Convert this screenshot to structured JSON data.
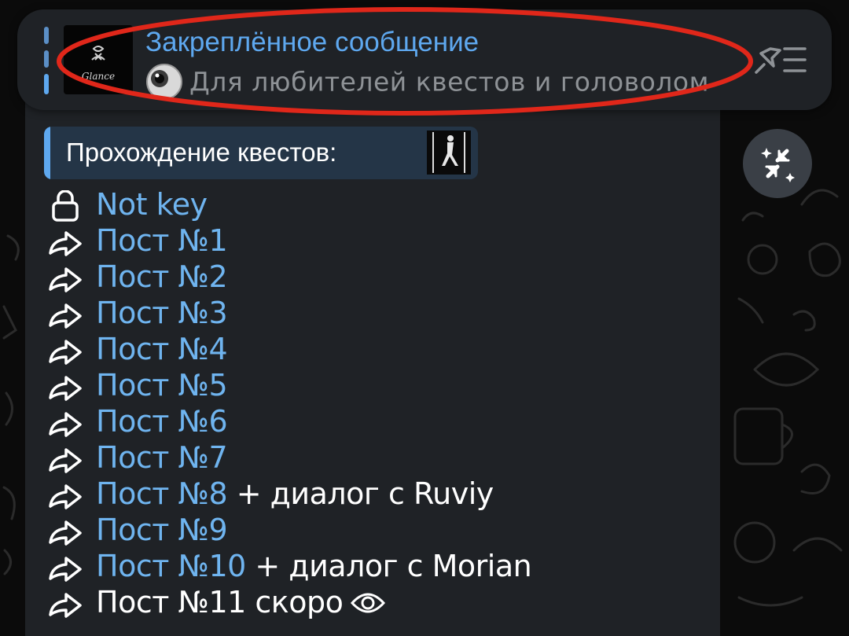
{
  "pinned": {
    "title": "Закреплённое сообщение",
    "preview": "Для любителей квестов и головолом",
    "thumb_caption": "Glance",
    "preview_emoji_icon": "eyeball-emoji",
    "list_icon": "pin-list-icon"
  },
  "quote": {
    "text": "Прохождение квестов:",
    "quote_mark": "❞"
  },
  "items": [
    {
      "icon": "lock-icon",
      "label": "Not key",
      "suffix": ""
    },
    {
      "icon": "forward-arrow-icon",
      "label": "Пост №1",
      "suffix": ""
    },
    {
      "icon": "forward-arrow-icon",
      "label": "Пост №2",
      "suffix": ""
    },
    {
      "icon": "forward-arrow-icon",
      "label": "Пост №3",
      "suffix": ""
    },
    {
      "icon": "forward-arrow-icon",
      "label": "Пост №4",
      "suffix": ""
    },
    {
      "icon": "forward-arrow-icon",
      "label": "Пост №5",
      "suffix": ""
    },
    {
      "icon": "forward-arrow-icon",
      "label": "Пост №6",
      "suffix": ""
    },
    {
      "icon": "forward-arrow-icon",
      "label": "Пост №7",
      "suffix": ""
    },
    {
      "icon": "forward-arrow-icon",
      "label": "Пост №8",
      "suffix": " + диалог с Ruviy"
    },
    {
      "icon": "forward-arrow-icon",
      "label": "Пост №9",
      "suffix": ""
    },
    {
      "icon": "forward-arrow-icon",
      "label": "Пост №10",
      "suffix": " + диалог с Morian"
    },
    {
      "icon": "forward-arrow-icon",
      "label": "Пост №11 скоро",
      "suffix": ""
    }
  ],
  "colors": {
    "accent": "#5ea8ef",
    "link": "#6fb4ef",
    "bubble": "#1f2226",
    "annotation": "#e0271a"
  }
}
